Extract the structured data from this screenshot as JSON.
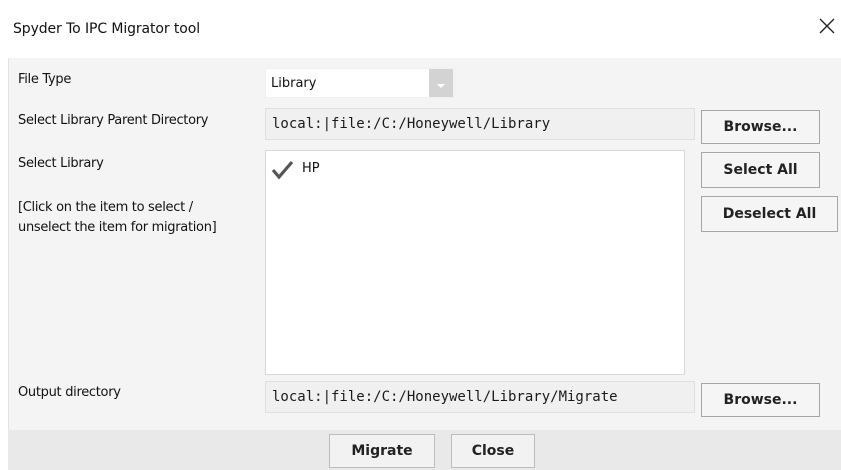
{
  "window": {
    "title": "Spyder To IPC Migrator tool"
  },
  "file_type": {
    "label": "File Type",
    "value": "Library"
  },
  "parent_dir": {
    "label": "Select Library Parent Directory",
    "value": "local:|file:/C:/Honeywell/Library",
    "browse_label": "Browse..."
  },
  "select_library": {
    "label": "Select Library",
    "hint_line1": "[Click on the item to select /",
    "hint_line2": "unselect the item for migration]",
    "items": [
      {
        "label": "HP",
        "checked": true
      }
    ],
    "select_all_label": "Select All",
    "deselect_all_label": "Deselect All"
  },
  "output_dir": {
    "label": "Output directory",
    "value": "local:|file:/C:/Honeywell/Library/Migrate",
    "browse_label": "Browse..."
  },
  "footer": {
    "migrate_label": "Migrate",
    "close_label": "Close"
  },
  "colors": {
    "dialog_bg": "#f4f4f4",
    "field_bg": "#f0f0f0",
    "check_color": "#555555"
  }
}
